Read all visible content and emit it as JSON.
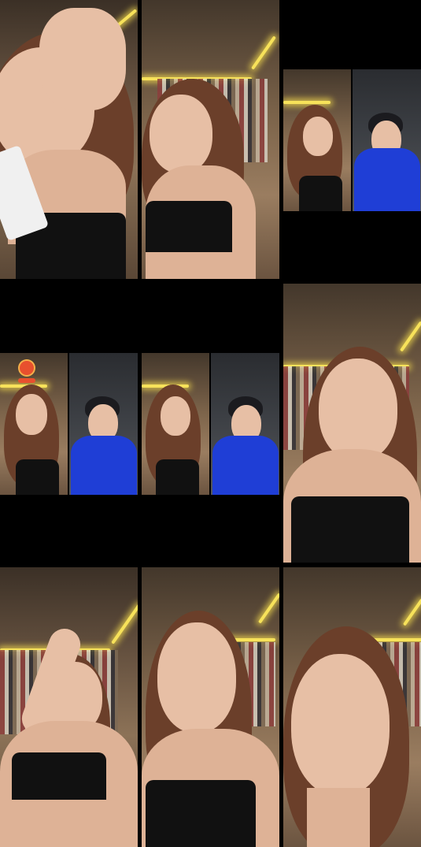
{
  "page": {
    "background": "#000000"
  },
  "tiles": [
    {
      "name": "tile-1",
      "kind": "single",
      "scene": "room-a"
    },
    {
      "name": "tile-2",
      "kind": "single",
      "scene": "room-b"
    },
    {
      "name": "tile-3",
      "kind": "split",
      "scenes": [
        "room-b",
        "room-c"
      ]
    },
    {
      "name": "tile-4",
      "kind": "split",
      "scenes": [
        "room-b",
        "room-c"
      ]
    },
    {
      "name": "tile-5",
      "kind": "split",
      "scenes": [
        "room-b",
        "room-c"
      ]
    },
    {
      "name": "tile-6",
      "kind": "single",
      "scene": "room-b"
    },
    {
      "name": "tile-7",
      "kind": "single",
      "scene": "room-a"
    },
    {
      "name": "tile-8",
      "kind": "single",
      "scene": "room-b"
    },
    {
      "name": "tile-9",
      "kind": "single",
      "scene": "room-b"
    }
  ],
  "colors": {
    "accent_light": "#f7e25a",
    "shirt": "#1f3ed6",
    "top": "#111111"
  }
}
